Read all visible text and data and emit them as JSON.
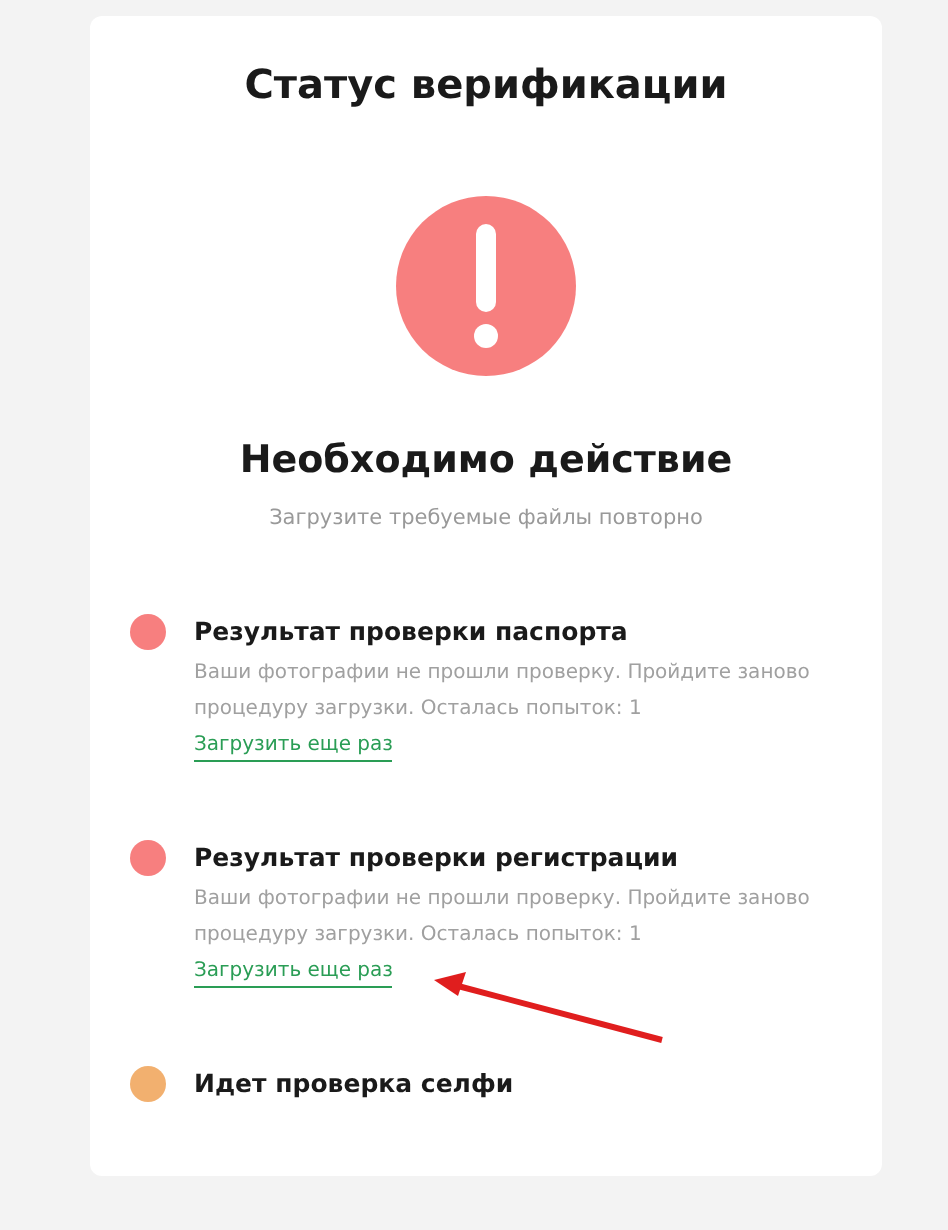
{
  "title": "Статус верификации",
  "status": {
    "heading": "Необходимо действие",
    "subtitle": "Загрузите требуемые файлы повторно"
  },
  "checks": [
    {
      "title": "Результат проверки паспорта",
      "color": "#f77f7f",
      "description": "Ваши фотографии не прошли проверку. Пройдите заново процедуру загрузки. Осталась попыток: 1",
      "link": "Загрузить еще раз"
    },
    {
      "title": "Результат проверки регистрации",
      "color": "#f77f7f",
      "description": "Ваши фотографии не прошли проверку. Пройдите заново процедуру загрузки. Осталась попыток: 1",
      "link": "Загрузить еще раз"
    },
    {
      "title": "Идет проверка селфи",
      "color": "#f2b06f"
    }
  ]
}
